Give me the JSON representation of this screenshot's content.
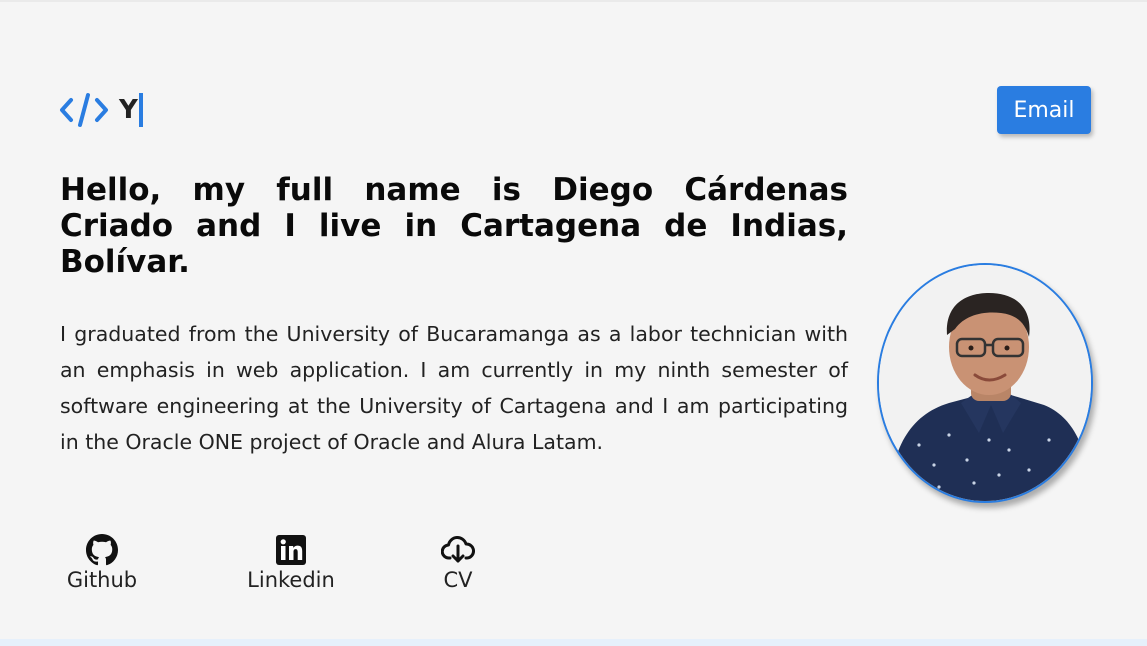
{
  "header": {
    "logo_icon": "code-icon",
    "typed_text": "Y",
    "email_button": "Email"
  },
  "hero": {
    "headline": "Hello, my full name is Diego Cárdenas Criado and I live in Cartagena de Indias, Bolívar.",
    "bio": "I graduated from the University of Bucaramanga as a labor technician with an emphasis in web application. I am currently in my ninth semester of software engineering at the University of Cartagena and I am participating in the Oracle ONE project of Oracle and Alura Latam."
  },
  "links": [
    {
      "label": "Github",
      "icon": "github-icon"
    },
    {
      "label": "Linkedin",
      "icon": "linkedin-icon"
    },
    {
      "label": "CV",
      "icon": "cloud-download-icon"
    }
  ],
  "profile": {
    "photo": "profile-photo"
  },
  "colors": {
    "accent": "#2a7de1",
    "background": "#f5f5f5",
    "text": "#111111"
  }
}
